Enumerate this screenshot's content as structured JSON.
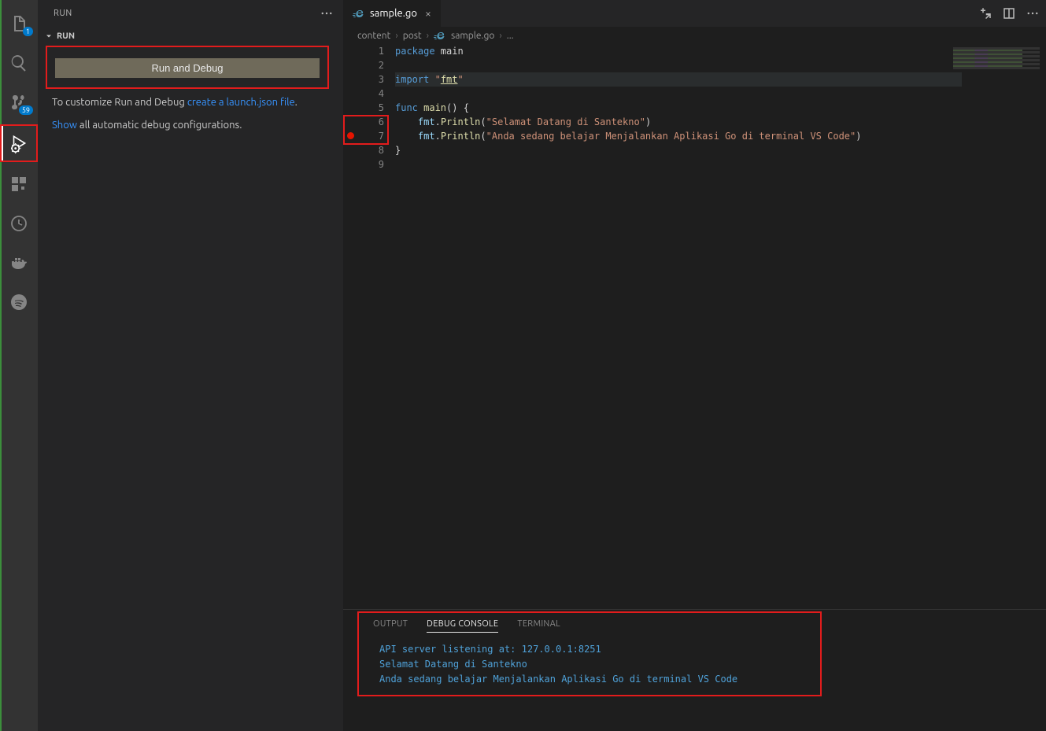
{
  "activity": {
    "explorer_badge": "1",
    "scm_badge": "59"
  },
  "sidebar": {
    "title": "RUN",
    "section_label": "RUN",
    "run_debug_label": "Run and Debug",
    "cfg_prefix": "To customize Run and Debug ",
    "cfg_link": "create a launch.json file",
    "cfg_suffix": ".",
    "show_link": "Show",
    "show_tail": " all automatic debug configurations."
  },
  "tab": {
    "name": "sample.go"
  },
  "breadcrumb": {
    "a": "content",
    "b": "post",
    "c": "sample.go",
    "d": "..."
  },
  "code": {
    "lines": [
      {
        "n": "1",
        "frag": [
          {
            "t": "package ",
            "c": "tok-kw"
          },
          {
            "t": "main",
            "c": ""
          }
        ]
      },
      {
        "n": "2",
        "frag": []
      },
      {
        "n": "3",
        "hl": true,
        "frag": [
          {
            "t": "import ",
            "c": "tok-kw"
          },
          {
            "t": "\"",
            "c": "tok-str"
          },
          {
            "t": "fmt",
            "c": "tok-yl"
          },
          {
            "t": "\"",
            "c": "tok-str"
          }
        ]
      },
      {
        "n": "4",
        "frag": []
      },
      {
        "n": "5",
        "frag": [
          {
            "t": "func ",
            "c": "tok-kw"
          },
          {
            "t": "main",
            "c": "tok-fn"
          },
          {
            "t": "() {",
            "c": ""
          }
        ]
      },
      {
        "n": "6",
        "frag": [
          {
            "t": "    ",
            "c": ""
          },
          {
            "t": "fmt",
            "c": "tok-pkg"
          },
          {
            "t": ".",
            "c": ""
          },
          {
            "t": "Println",
            "c": "tok-fn"
          },
          {
            "t": "(",
            "c": ""
          },
          {
            "t": "\"Selamat Datang di Santekno\"",
            "c": "tok-str"
          },
          {
            "t": ")",
            "c": ""
          }
        ]
      },
      {
        "n": "7",
        "bp": true,
        "frag": [
          {
            "t": "    ",
            "c": ""
          },
          {
            "t": "fmt",
            "c": "tok-pkg"
          },
          {
            "t": ".",
            "c": ""
          },
          {
            "t": "Println",
            "c": "tok-fn"
          },
          {
            "t": "(",
            "c": ""
          },
          {
            "t": "\"Anda sedang belajar Menjalankan Aplikasi Go di terminal VS Code\"",
            "c": "tok-str"
          },
          {
            "t": ")",
            "c": ""
          }
        ]
      },
      {
        "n": "8",
        "frag": [
          {
            "t": "}",
            "c": ""
          }
        ]
      },
      {
        "n": "9",
        "frag": []
      }
    ]
  },
  "panel": {
    "tab_output": "OUTPUT",
    "tab_debug": "DEBUG CONSOLE",
    "tab_terminal": "TERMINAL",
    "lines": [
      "API server listening at: 127.0.0.1:8251",
      "Selamat Datang di Santekno",
      "Anda sedang belajar Menjalankan Aplikasi Go di terminal VS Code"
    ]
  }
}
